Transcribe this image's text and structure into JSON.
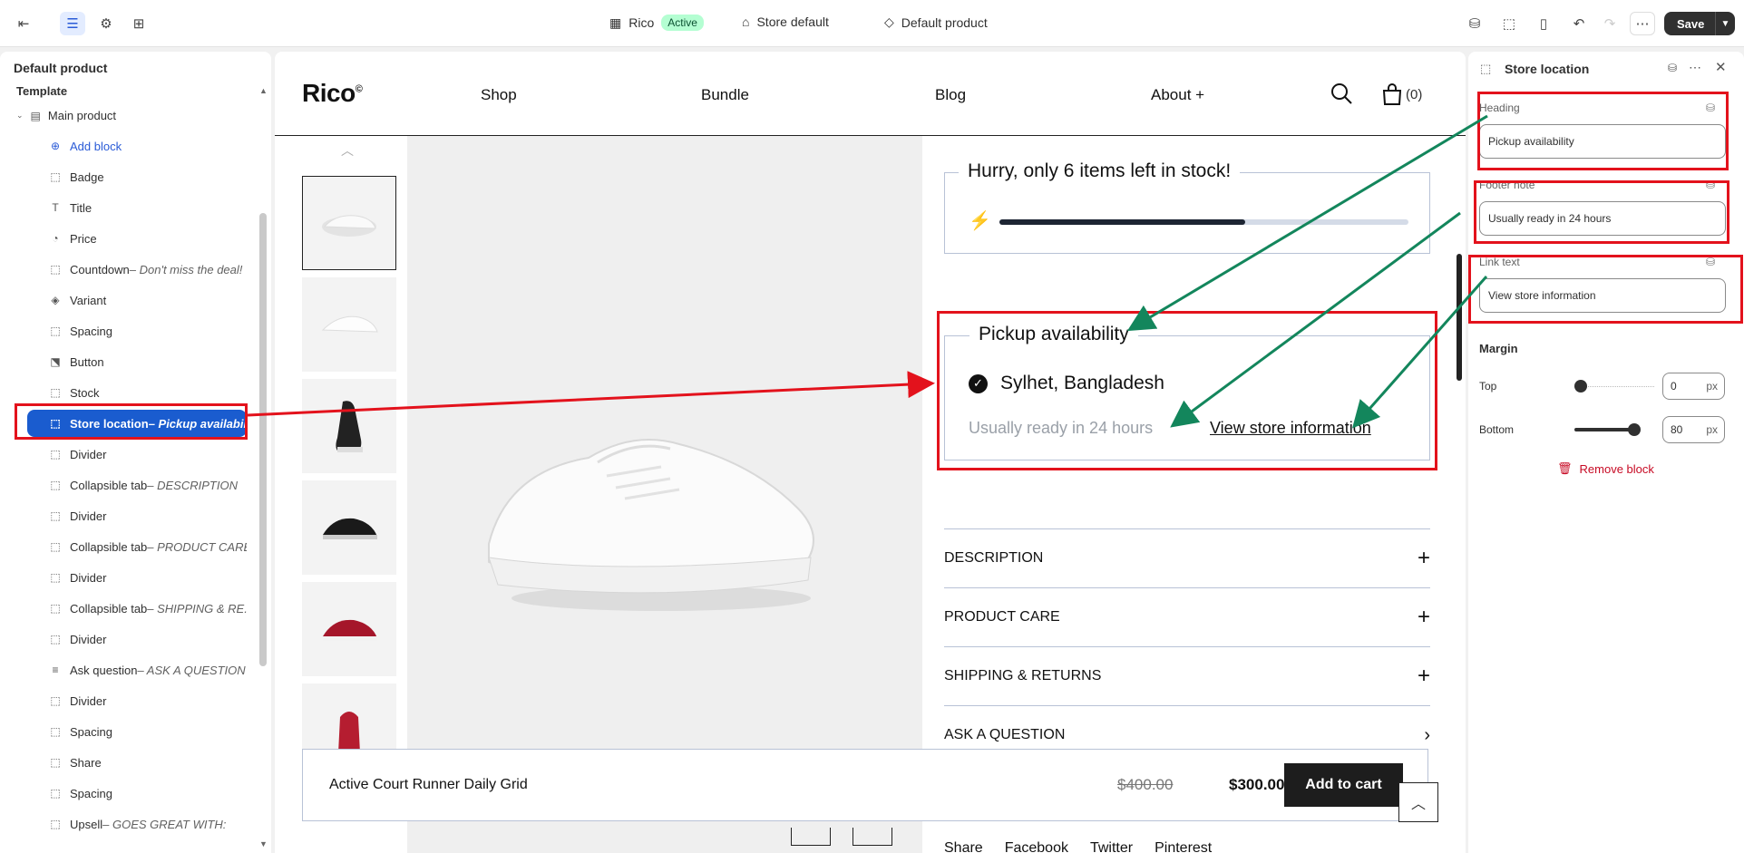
{
  "topbar": {
    "theme_name": "Rico",
    "theme_status": "Active",
    "store": "Store default",
    "template": "Default product",
    "save_label": "Save",
    "more_icon": "ellipsis-icon"
  },
  "left": {
    "title": "Default product",
    "section": "Template",
    "main": "Main product",
    "items": [
      {
        "icon": "plus-circle-icon",
        "label": "Add block",
        "sub": ""
      },
      {
        "icon": "block-icon",
        "label": "Badge",
        "sub": ""
      },
      {
        "icon": "text-icon",
        "label": "Title",
        "sub": ""
      },
      {
        "icon": "price-icon",
        "label": "Price",
        "sub": ""
      },
      {
        "icon": "block-icon",
        "label": "Countdown",
        "sub": " – Don't miss the deal!"
      },
      {
        "icon": "variant-icon",
        "label": "Variant",
        "sub": ""
      },
      {
        "icon": "block-icon",
        "label": "Spacing",
        "sub": ""
      },
      {
        "icon": "button-icon",
        "label": "Button",
        "sub": ""
      },
      {
        "icon": "block-icon",
        "label": "Stock",
        "sub": ""
      },
      {
        "icon": "block-icon",
        "label": "Store location",
        "sub": " – Pickup availabili..."
      },
      {
        "icon": "block-icon",
        "label": "Divider",
        "sub": ""
      },
      {
        "icon": "block-icon",
        "label": "Collapsible tab",
        "sub": " – DESCRIPTION"
      },
      {
        "icon": "block-icon",
        "label": "Divider",
        "sub": ""
      },
      {
        "icon": "block-icon",
        "label": "Collapsible tab",
        "sub": " – PRODUCT CARE"
      },
      {
        "icon": "block-icon",
        "label": "Divider",
        "sub": ""
      },
      {
        "icon": "block-icon",
        "label": "Collapsible tab",
        "sub": " – SHIPPING & RE..."
      },
      {
        "icon": "block-icon",
        "label": "Divider",
        "sub": ""
      },
      {
        "icon": "lines-icon",
        "label": "Ask question",
        "sub": " – ASK A QUESTION"
      },
      {
        "icon": "block-icon",
        "label": "Divider",
        "sub": ""
      },
      {
        "icon": "block-icon",
        "label": "Spacing",
        "sub": ""
      },
      {
        "icon": "block-icon",
        "label": "Share",
        "sub": ""
      },
      {
        "icon": "block-icon",
        "label": "Spacing",
        "sub": ""
      },
      {
        "icon": "block-icon",
        "label": "Upsell",
        "sub": " – GOES GREAT WITH:"
      }
    ]
  },
  "store": {
    "logo": "Rico",
    "logo_mark": "©",
    "nav": [
      "Shop",
      "Bundle",
      "Blog",
      "About +"
    ],
    "cart": "(0)",
    "stock_title": "Hurry, only 6 items left in stock!",
    "stock_progress": 0.6,
    "pickup_title": "Pickup availability",
    "pickup_location": "Sylhet, Bangladesh",
    "pickup_note": "Usually ready in 24 hours",
    "pickup_link": "View store information",
    "accordions": [
      "DESCRIPTION",
      "PRODUCT CARE",
      "SHIPPING & RETURNS",
      "ASK A QUESTION"
    ],
    "sticky_title": "Active Court Runner Daily Grid",
    "old_price": "$400.00",
    "new_price": "$300.00",
    "add_to_cart": "Add to cart",
    "share": [
      "Share",
      "Facebook",
      "Twitter",
      "Pinterest"
    ]
  },
  "right": {
    "title": "Store location",
    "heading_label": "Heading",
    "heading_value": "Pickup availability",
    "footer_label": "Footer note",
    "footer_value": "Usually ready in 24 hours",
    "link_label": "Link text",
    "link_value": "View store information",
    "margin_title": "Margin",
    "top_label": "Top",
    "top_value": "0",
    "bottom_label": "Bottom",
    "bottom_value": "80",
    "unit": "px",
    "remove": "Remove block"
  },
  "colors": {
    "accent": "#1a5ccf",
    "annotation_red": "#e3121c",
    "annotation_green": "#13865c"
  }
}
